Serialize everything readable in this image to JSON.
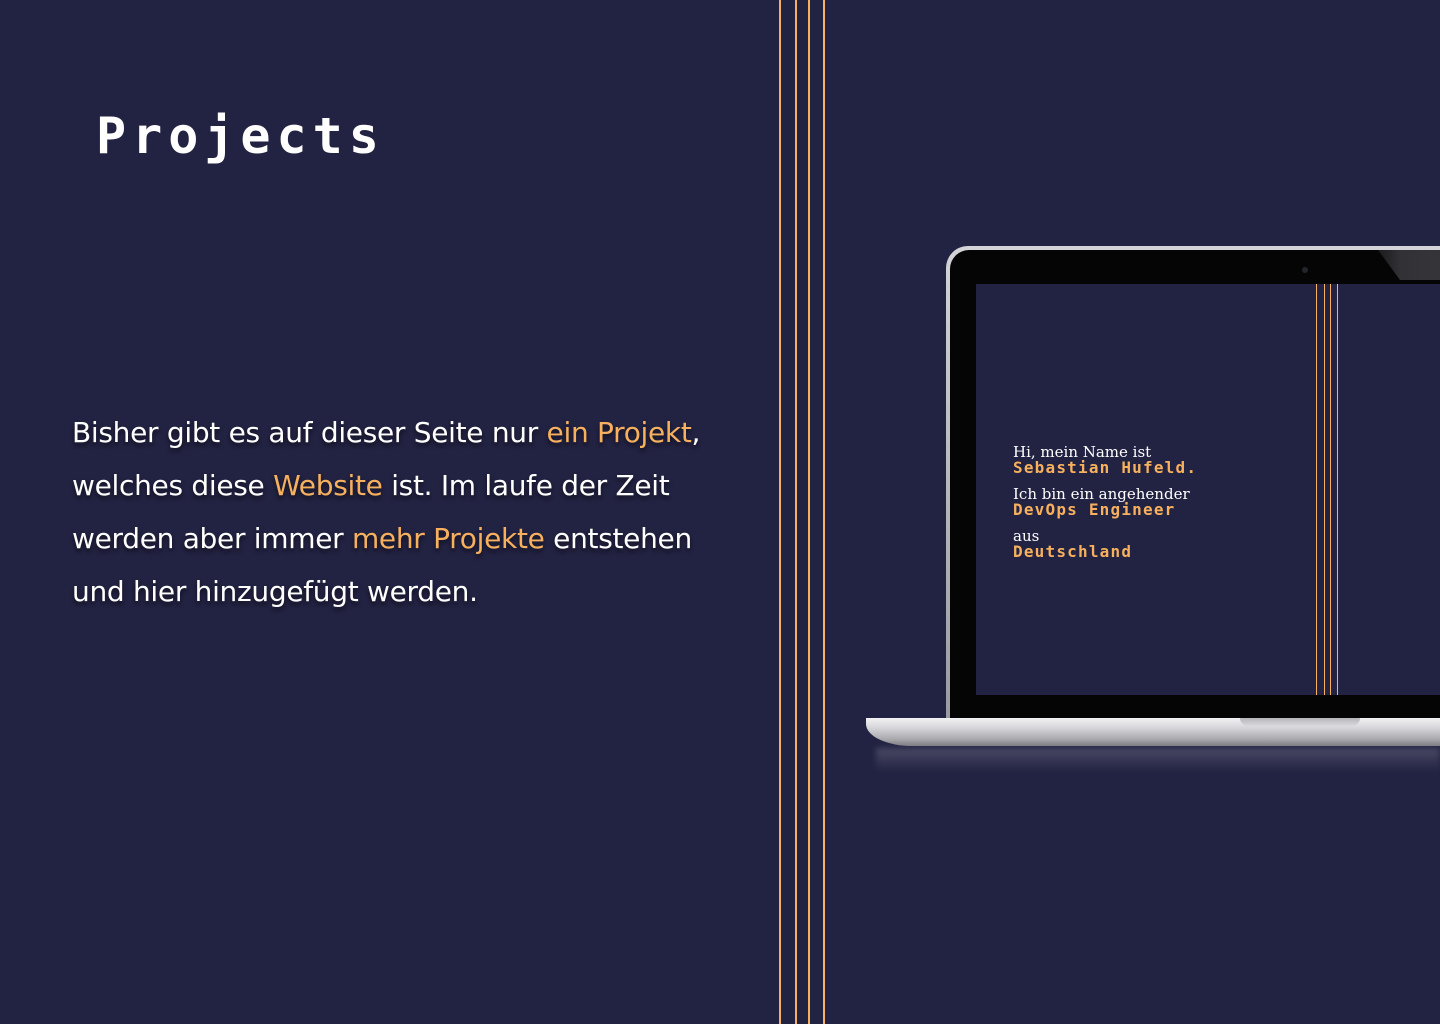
{
  "page": {
    "title": "Projects",
    "intro": [
      {
        "text": "Bisher gibt es auf dieser Seite nur ",
        "highlight": false
      },
      {
        "text": "ein Projekt",
        "highlight": true
      },
      {
        "text": ", welches diese ",
        "highlight": false
      },
      {
        "text": "Website",
        "highlight": true
      },
      {
        "text": " ist. Im laufe der Zeit werden aber immer ",
        "highlight": false
      },
      {
        "text": "mehr Projekte",
        "highlight": true
      },
      {
        "text": " entstehen und hier hinzugefügt werden.",
        "highlight": false
      }
    ]
  },
  "laptop_screen": {
    "greeting_label": "Hi, mein Name ist",
    "name": "Sebastian Hufeld.",
    "role_label": "Ich bin ein angehender",
    "role": "DevOps Engineer",
    "origin_label": "aus",
    "origin": "Deutschland"
  },
  "colors": {
    "background": "#222242",
    "accent": "#f6b05e",
    "text": "#ffffff"
  }
}
